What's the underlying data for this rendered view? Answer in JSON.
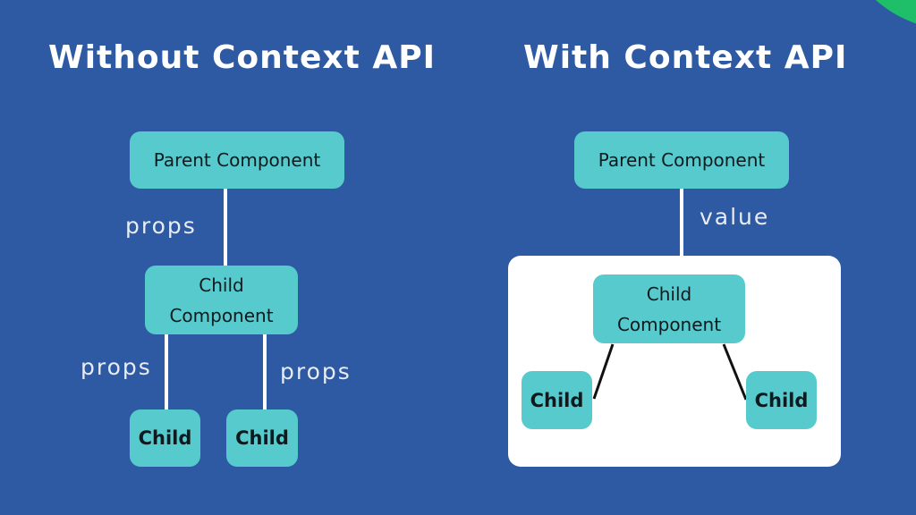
{
  "decor": {
    "corner_color": "#1fbf6a",
    "background_color": "#2e59a3",
    "node_color": "#56cacc"
  },
  "left": {
    "title": "Without Context API",
    "parent": "Parent Component",
    "edge_parent_child": "props",
    "child": "Child\nComponent",
    "edge_left": "props",
    "edge_right": "props",
    "leaf_left": "Child",
    "leaf_right": "Child"
  },
  "right": {
    "title": "With Context API",
    "parent": "Parent Component",
    "edge_parent_context": "value",
    "child": "Child\nComponent",
    "leaf_left": "Child",
    "leaf_right": "Child"
  }
}
